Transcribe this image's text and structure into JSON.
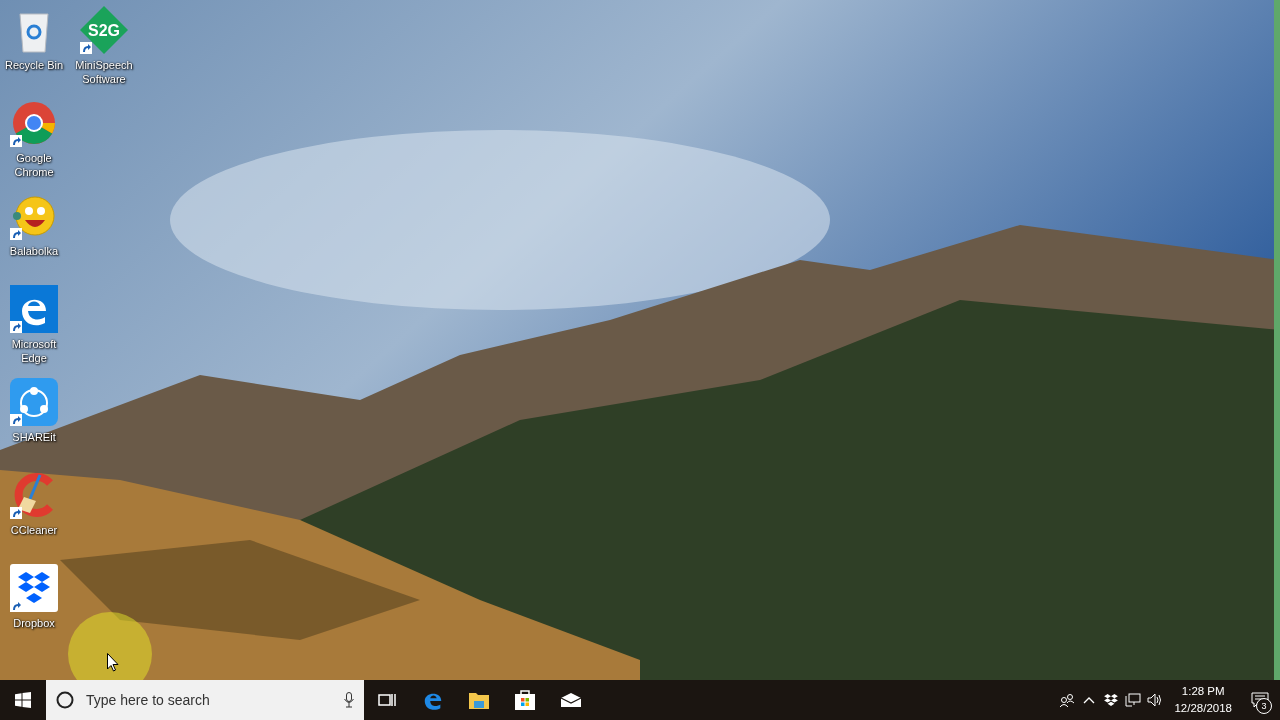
{
  "desktop_icons": [
    {
      "kind": "recycle",
      "label": "Recycle Bin",
      "shortcut": false
    },
    {
      "kind": "logo",
      "logo_text": "S2G",
      "label": "MiniSpeech Software",
      "shortcut": true
    },
    {
      "kind": "chrome",
      "label": "Google Chrome",
      "shortcut": true
    },
    {
      "kind": "balabolka",
      "label": "Balabolka",
      "shortcut": true
    },
    {
      "kind": "edge",
      "label": "Microsoft Edge",
      "shortcut": true
    },
    {
      "kind": "shareit",
      "label": "SHAREit",
      "shortcut": true
    },
    {
      "kind": "ccleaner",
      "label": "CCleaner",
      "shortcut": true
    },
    {
      "kind": "dropbox",
      "label": "Dropbox",
      "shortcut": true
    }
  ],
  "taskbar": {
    "search": {
      "placeholder": "Type here to search"
    },
    "pinned": [
      {
        "kind": "taskview"
      },
      {
        "kind": "edge"
      },
      {
        "kind": "explorer"
      },
      {
        "kind": "store"
      },
      {
        "kind": "mail"
      }
    ],
    "tray": [
      {
        "kind": "people"
      },
      {
        "kind": "caret"
      },
      {
        "kind": "dropbox"
      },
      {
        "kind": "network"
      },
      {
        "kind": "volume"
      }
    ],
    "clock": {
      "time": "1:28 PM",
      "date": "12/28/2018"
    },
    "notifications": {
      "count": "3"
    }
  }
}
